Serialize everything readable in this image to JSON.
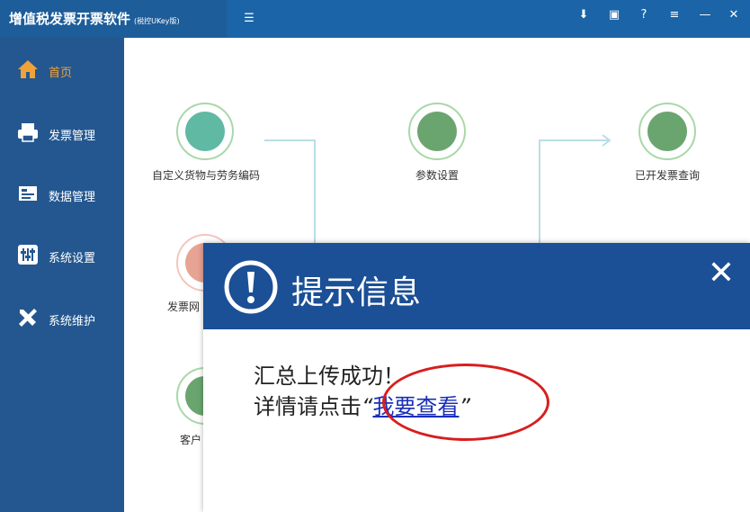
{
  "app": {
    "title": "增值税发票开票软件",
    "subtitle": "(税控UKey版)"
  },
  "toolbar": {
    "collapse_icon": "list-collapse-icon",
    "download_icon": "download-icon",
    "save_icon": "save-icon",
    "help_label": "?",
    "menu_icon": "menu-icon",
    "minimize_icon": "minimize-icon",
    "close_icon": "close-icon"
  },
  "sidebar": {
    "items": [
      {
        "label": "首页",
        "icon": "home-icon",
        "active": true
      },
      {
        "label": "发票管理",
        "icon": "printer-icon"
      },
      {
        "label": "数据管理",
        "icon": "data-icon"
      },
      {
        "label": "系统设置",
        "icon": "settings-sliders-icon"
      },
      {
        "label": "系统维护",
        "icon": "tools-icon"
      }
    ]
  },
  "home": {
    "nodes": [
      {
        "label": "自定义货物与劳务编码",
        "icon": "wallet-icon"
      },
      {
        "label": "参数设置",
        "icon": "sliders-icon"
      },
      {
        "label": "已开发票查询",
        "icon": "invoice-search-icon"
      },
      {
        "label": "发票网",
        "icon": "monitor-icon"
      },
      {
        "label": "客户",
        "icon": "client-icon"
      }
    ]
  },
  "dialog": {
    "title": "提示信息",
    "icon": "alert-exclamation-icon",
    "close_icon": "close-icon",
    "line1": "汇总上传成功！",
    "line2_prefix": "详情请点击",
    "open_quote": "“",
    "link": "我要查看",
    "close_quote": "”"
  },
  "colors": {
    "titlebar": "#1a64a7",
    "sidebar": "#24578f",
    "active": "#f0a23a",
    "dialog_header": "#1b4f96",
    "link": "#1a2fb8",
    "highlight_ring": "#d81e1e",
    "node_green": "#6aa56f"
  }
}
